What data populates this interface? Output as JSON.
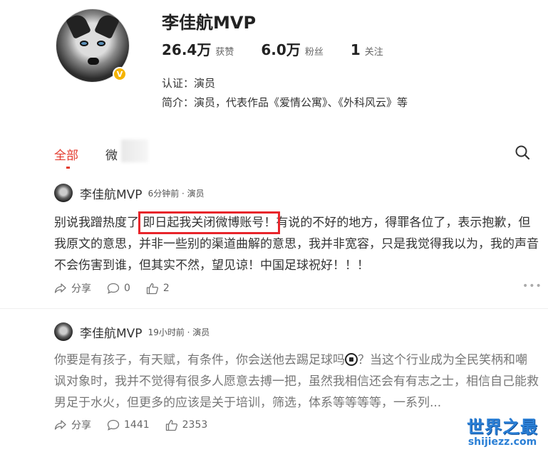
{
  "profile": {
    "name": "李佳航MVP",
    "stats": [
      {
        "num": "26.4万",
        "label": "获赞"
      },
      {
        "num": "6.0万",
        "label": "粉丝"
      },
      {
        "num": "1",
        "label": "关注"
      }
    ],
    "certification": "认证：演员",
    "bio": "简介：演员，代表作品《爱情公寓》、《外科风云》等",
    "badge": "V"
  },
  "tabs": {
    "all": "全部",
    "weibo": "微"
  },
  "posts": [
    {
      "author": "李佳航MVP",
      "meta": "6分钟前 · 演员",
      "text_before": "别说我蹭热度了 ",
      "text_highlight": "即日起我关闭微博账号！",
      "text_after": "有说的不好的地方，得罪各位了，表示抱歉，但我原文的意思，并非一些别的渠道曲解的意思，我并非宽容，只是我觉得我以为，我的声音不会伤害到谁，但其实不然，望见谅！中国足球祝好！！！",
      "share": "分享",
      "comments": "0",
      "likes": "2"
    },
    {
      "author": "李佳航MVP",
      "meta": "19小时前 · 演员",
      "text_before": "你要是有孩子，有天赋，有条件，你会送他去踢足球吗",
      "text_after": "？当这个行业成为全民笑柄和嘲讽对象时，我并不觉得有很多人愿意去搏一把，虽然我相信还会有有志之士，相信自己能救男足于水火，但更多的应该是关于培训，筛选，体系等等等等，一系列...",
      "share": "分享",
      "comments": "1441",
      "likes": "2353"
    }
  ],
  "watermark": {
    "main": "世界之最",
    "sub": "shijiezz.com"
  },
  "colors": {
    "accent": "#e33b2e",
    "highlight_box": "#e8252b",
    "badge": "#f5b400",
    "watermark": "#2a7fd6"
  }
}
